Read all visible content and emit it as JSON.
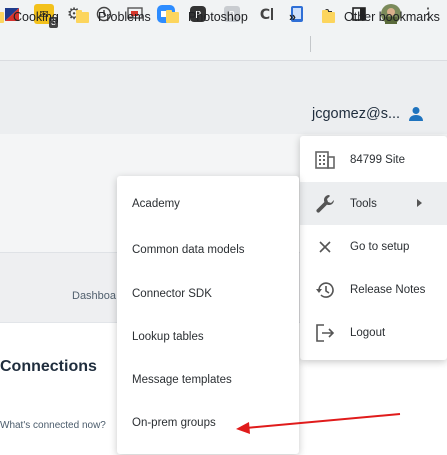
{
  "browser": {
    "extensions": [
      {
        "icon": "flag-icon"
      },
      {
        "icon": "extension-badge-icon",
        "badge": "3"
      },
      {
        "icon": "gear-icon"
      },
      {
        "icon": "clock-icon"
      },
      {
        "icon": "cast-icon"
      },
      {
        "icon": "video-icon"
      },
      {
        "icon": "reader-icon"
      },
      {
        "icon": "r-icon"
      },
      {
        "icon": "c-icon"
      },
      {
        "icon": "phone-icon"
      },
      {
        "icon": "puzzle-icon"
      },
      {
        "icon": "sidepanel-icon"
      },
      {
        "icon": "avatar-icon"
      },
      {
        "icon": "kebab-icon"
      }
    ],
    "bookmarks": [
      {
        "label": "Cooking"
      },
      {
        "label": "Problems"
      },
      {
        "label": "Photoshop"
      }
    ],
    "bookmarks_overflow": "»",
    "other_bookmarks": "Other bookmarks"
  },
  "header": {
    "user_email": "jcgomez@s...",
    "user_icon": "person-icon"
  },
  "page": {
    "dashboard_link": "Dashboa",
    "connections_title": "Connections",
    "connected_link": "What's connected now?"
  },
  "user_menu": {
    "items": [
      {
        "label": "84799 Site",
        "icon": "building-icon"
      },
      {
        "label": "Tools",
        "icon": "wrench-icon",
        "submenu": true,
        "highlighted": true
      },
      {
        "label": "Go to setup",
        "icon": "close-icon"
      },
      {
        "label": "Release Notes",
        "icon": "history-icon"
      },
      {
        "label": "Logout",
        "icon": "logout-icon"
      }
    ]
  },
  "tools_menu": {
    "items": [
      {
        "label": "Academy"
      },
      {
        "label": "Common data models"
      },
      {
        "label": "Connector SDK"
      },
      {
        "label": "Lookup tables"
      },
      {
        "label": "Message templates"
      },
      {
        "label": "On-prem groups"
      }
    ]
  },
  "colors": {
    "accent": "#1e73be",
    "annotation_arrow": "#e01b1b",
    "folder": "#fcd55d"
  }
}
